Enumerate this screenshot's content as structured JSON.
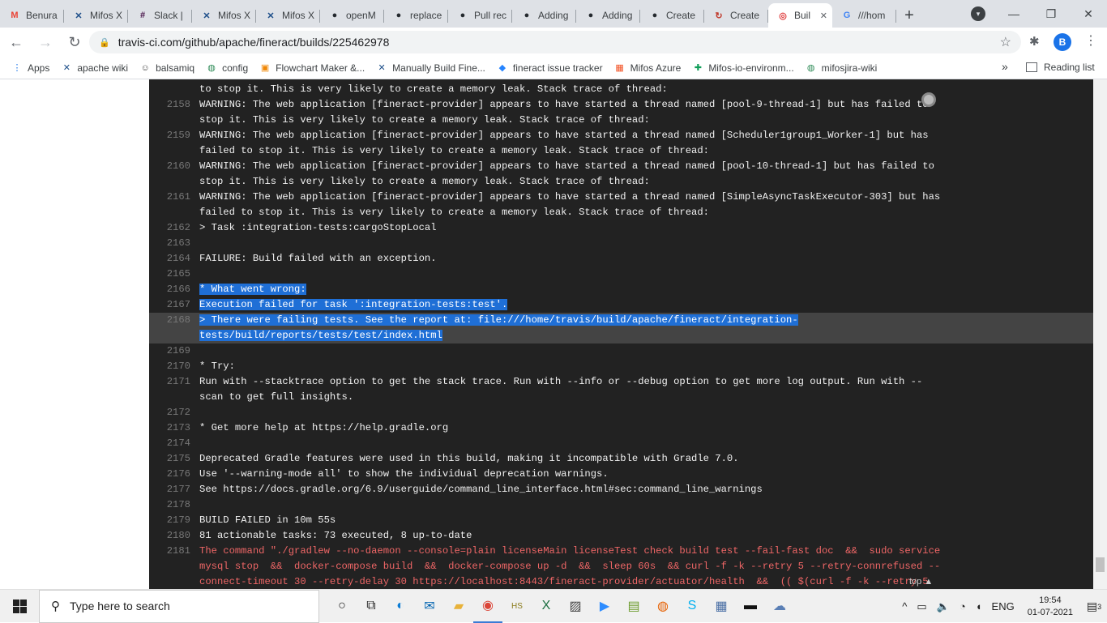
{
  "browser": {
    "tabs": [
      {
        "label": "Benura",
        "icon": "gmail-icon",
        "color": "#ea4335",
        "glyph": "M"
      },
      {
        "label": "Mifos X",
        "icon": "confluence-icon",
        "color": "#1d4e89",
        "glyph": "✕"
      },
      {
        "label": "Slack | ",
        "icon": "slack-icon",
        "color": "#4a154b",
        "glyph": "#"
      },
      {
        "label": "Mifos X",
        "icon": "confluence-icon",
        "color": "#1d4e89",
        "glyph": "✕"
      },
      {
        "label": "Mifos X",
        "icon": "confluence-icon",
        "color": "#1d4e89",
        "glyph": "✕"
      },
      {
        "label": "openM",
        "icon": "github-icon",
        "color": "#24292e",
        "glyph": "●"
      },
      {
        "label": "replace",
        "icon": "github-icon",
        "color": "#24292e",
        "glyph": "●"
      },
      {
        "label": "Pull rec",
        "icon": "github-icon",
        "color": "#24292e",
        "glyph": "●"
      },
      {
        "label": "Adding",
        "icon": "github-icon",
        "color": "#24292e",
        "glyph": "●"
      },
      {
        "label": "Adding",
        "icon": "github-icon",
        "color": "#24292e",
        "glyph": "●"
      },
      {
        "label": "Create",
        "icon": "github-icon",
        "color": "#24292e",
        "glyph": "●"
      },
      {
        "label": "Create",
        "icon": "circleci-icon",
        "color": "#c0392b",
        "glyph": "↻"
      },
      {
        "label": "Buil",
        "icon": "travis-icon",
        "color": "#e04040",
        "glyph": "◎",
        "active": true
      },
      {
        "label": "///hom",
        "icon": "google-icon",
        "color": "#4285f4",
        "glyph": "G"
      }
    ],
    "new_tab": "+",
    "address": "travis-ci.com/github/apache/fineract/builds/225462978",
    "profile_initial": "B",
    "bookmarks": [
      {
        "label": "Apps",
        "icon": "apps-grid-icon",
        "color": "#1a73e8",
        "glyph": "⋮"
      },
      {
        "label": "apache wiki",
        "icon": "confluence-icon",
        "color": "#1d4e89",
        "glyph": "✕"
      },
      {
        "label": "balsamiq",
        "icon": "balsamiq-icon",
        "color": "#444444",
        "glyph": "☺"
      },
      {
        "label": "config",
        "icon": "globe-icon",
        "color": "#2e8b57",
        "glyph": "◍"
      },
      {
        "label": "Flowchart Maker &...",
        "icon": "drawio-icon",
        "color": "#f08705",
        "glyph": "▣"
      },
      {
        "label": "Manually Build Fine...",
        "icon": "confluence-icon",
        "color": "#1d4e89",
        "glyph": "✕"
      },
      {
        "label": "fineract issue tracker",
        "icon": "jira-icon",
        "color": "#2684ff",
        "glyph": "◆"
      },
      {
        "label": "Mifos Azure",
        "icon": "microsoft-icon",
        "color": "#f25022",
        "glyph": "▦"
      },
      {
        "label": "Mifos-io-environm...",
        "icon": "sheets-icon",
        "color": "#0f9d58",
        "glyph": "✚"
      },
      {
        "label": "mifosjira-wiki",
        "icon": "globe-icon",
        "color": "#2e8b57",
        "glyph": "◍"
      }
    ],
    "bookmarks_more": "»",
    "reading_list": "Reading list"
  },
  "log": {
    "lines": [
      {
        "num": "",
        "text": "to stop it. This is very likely to create a memory leak. Stack trace of thread:"
      },
      {
        "num": "2158",
        "text": "WARNING: The web application [fineract-provider] appears to have started a thread named [pool-9-thread-1] but has failed to\nstop it. This is very likely to create a memory leak. Stack trace of thread:"
      },
      {
        "num": "2159",
        "text": "WARNING: The web application [fineract-provider] appears to have started a thread named [Scheduler1group1_Worker-1] but has\nfailed to stop it. This is very likely to create a memory leak. Stack trace of thread:"
      },
      {
        "num": "2160",
        "text": "WARNING: The web application [fineract-provider] appears to have started a thread named [pool-10-thread-1] but has failed to\nstop it. This is very likely to create a memory leak. Stack trace of thread:"
      },
      {
        "num": "2161",
        "text": "WARNING: The web application [fineract-provider] appears to have started a thread named [SimpleAsyncTaskExecutor-303] but has\nfailed to stop it. This is very likely to create a memory leak. Stack trace of thread:"
      },
      {
        "num": "2162",
        "text": "> Task :integration-tests:cargoStopLocal"
      },
      {
        "num": "2163",
        "text": ""
      },
      {
        "num": "2164",
        "text": "FAILURE: Build failed with an exception."
      },
      {
        "num": "2165",
        "text": ""
      },
      {
        "num": "2166",
        "text": "* What went wrong:",
        "selected": true
      },
      {
        "num": "2167",
        "text": "Execution failed for task ':integration-tests:test'.",
        "selected": true
      },
      {
        "num": "2168",
        "text": "> There were failing tests. See the report at: file:///home/travis/build/apache/fineract/integration-\ntests/build/reports/tests/test/index.html",
        "selected": true,
        "highlight": true
      },
      {
        "num": "2169",
        "text": ""
      },
      {
        "num": "2170",
        "text": "* Try:"
      },
      {
        "num": "2171",
        "text": "Run with --stacktrace option to get the stack trace. Run with --info or --debug option to get more log output. Run with --\nscan to get full insights."
      },
      {
        "num": "2172",
        "text": ""
      },
      {
        "num": "2173",
        "text": "* Get more help at https://help.gradle.org"
      },
      {
        "num": "2174",
        "text": ""
      },
      {
        "num": "2175",
        "text": "Deprecated Gradle features were used in this build, making it incompatible with Gradle 7.0."
      },
      {
        "num": "2176",
        "text": "Use '--warning-mode all' to show the individual deprecation warnings."
      },
      {
        "num": "2177",
        "text": "See https://docs.gradle.org/6.9/userguide/command_line_interface.html#sec:command_line_warnings"
      },
      {
        "num": "2178",
        "text": ""
      },
      {
        "num": "2179",
        "text": "BUILD FAILED in 10m 55s"
      },
      {
        "num": "2180",
        "text": "81 actionable tasks: 73 executed, 8 up-to-date"
      },
      {
        "num": "2181",
        "text": "The command \"./gradlew --no-daemon --console=plain licenseMain licenseTest check build test --fail-fast doc  &&  sudo service\nmysql stop  &&  docker-compose build  &&  docker-compose up -d  &&  sleep 60s  && curl -f -k --retry 5 --retry-connrefused --\nconnect-timeout 30 --retry-delay 30 https://localhost:8443/fineract-provider/actuator/health  &&  (( $(curl -f -k --retry 5",
        "error": true
      }
    ],
    "top_link": "top"
  },
  "taskbar": {
    "search_placeholder": "Type here to search",
    "apps": [
      {
        "name": "cortana-icon",
        "glyph": "○"
      },
      {
        "name": "task-view-icon",
        "glyph": "⧉"
      },
      {
        "name": "edge-icon",
        "glyph": "◐",
        "color": "#0c7cd5"
      },
      {
        "name": "mail-icon",
        "glyph": "✉",
        "color": "#0063b1"
      },
      {
        "name": "file-explorer-icon",
        "glyph": "▰",
        "color": "#e8b23a"
      },
      {
        "name": "chrome-icon",
        "glyph": "◉",
        "color": "#db4437",
        "active": true
      },
      {
        "name": "hs-icon",
        "glyph": "HS",
        "color": "#8a7a1a"
      },
      {
        "name": "excel-icon",
        "glyph": "X",
        "color": "#1d6f42"
      },
      {
        "name": "app-icon",
        "glyph": "▨",
        "color": "#444444"
      },
      {
        "name": "zoom-icon",
        "glyph": "▶",
        "color": "#2d8cff"
      },
      {
        "name": "chart-app-icon",
        "glyph": "▤",
        "color": "#6a9a2a"
      },
      {
        "name": "firefox-icon",
        "glyph": "◍",
        "color": "#e66000"
      },
      {
        "name": "skype-icon",
        "glyph": "S",
        "color": "#00aff0"
      },
      {
        "name": "network-app-icon",
        "glyph": "▦",
        "color": "#4a6fa5"
      },
      {
        "name": "terminal-icon",
        "glyph": "▬",
        "color": "#111111"
      },
      {
        "name": "weather-icon",
        "glyph": "☁",
        "color": "#5a7fb5"
      }
    ],
    "tray_up": "^",
    "language": "ENG",
    "time": "19:54",
    "date": "01-07-2021",
    "notifications": "3"
  }
}
